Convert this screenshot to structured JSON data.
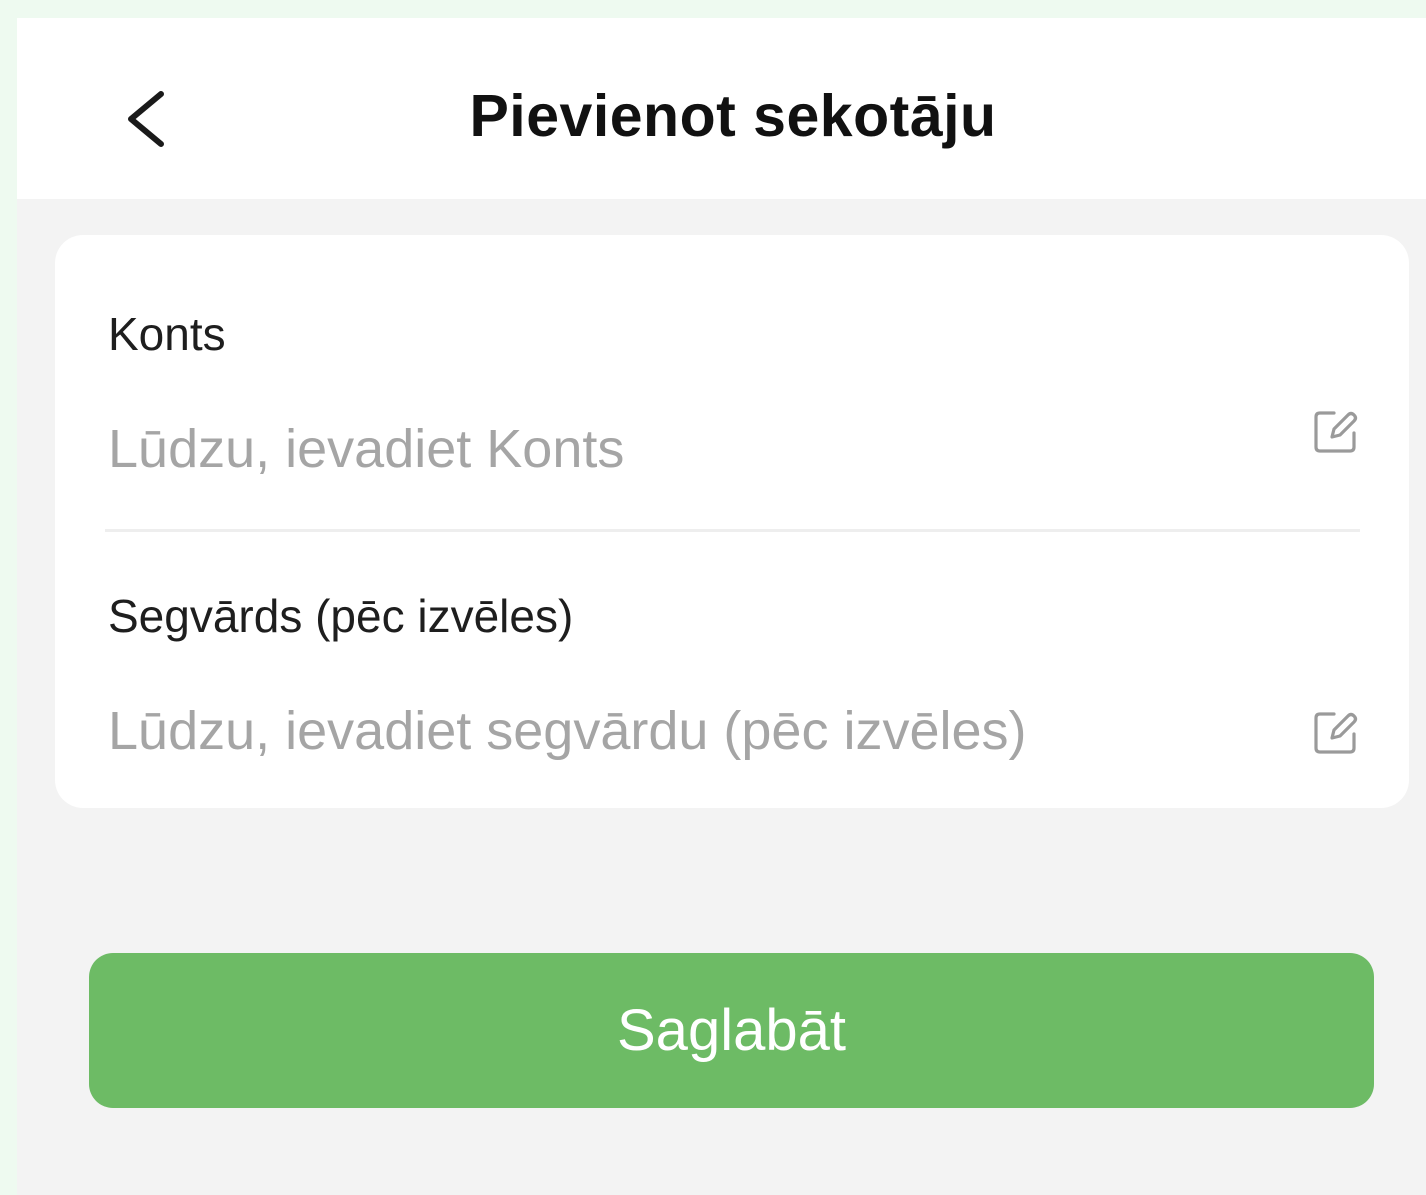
{
  "header": {
    "title": "Pievienot sekotāju",
    "back_icon": "chevron-left-icon"
  },
  "form": {
    "account": {
      "label": "Konts",
      "placeholder": "Lūdzu, ievadiet Konts",
      "value": "",
      "icon": "edit-icon"
    },
    "nickname": {
      "label": "Segvārds (pēc izvēles)",
      "placeholder": "Lūdzu, ievadiet segvārdu (pēc izvēles)",
      "value": "",
      "icon": "edit-icon"
    }
  },
  "actions": {
    "save_label": "Saglabāt"
  },
  "colors": {
    "accent": "#6dbb65",
    "background": "#f3f3f3",
    "surface": "#ffffff",
    "placeholder": "#a5a5a5",
    "text": "#1e1e1e"
  }
}
